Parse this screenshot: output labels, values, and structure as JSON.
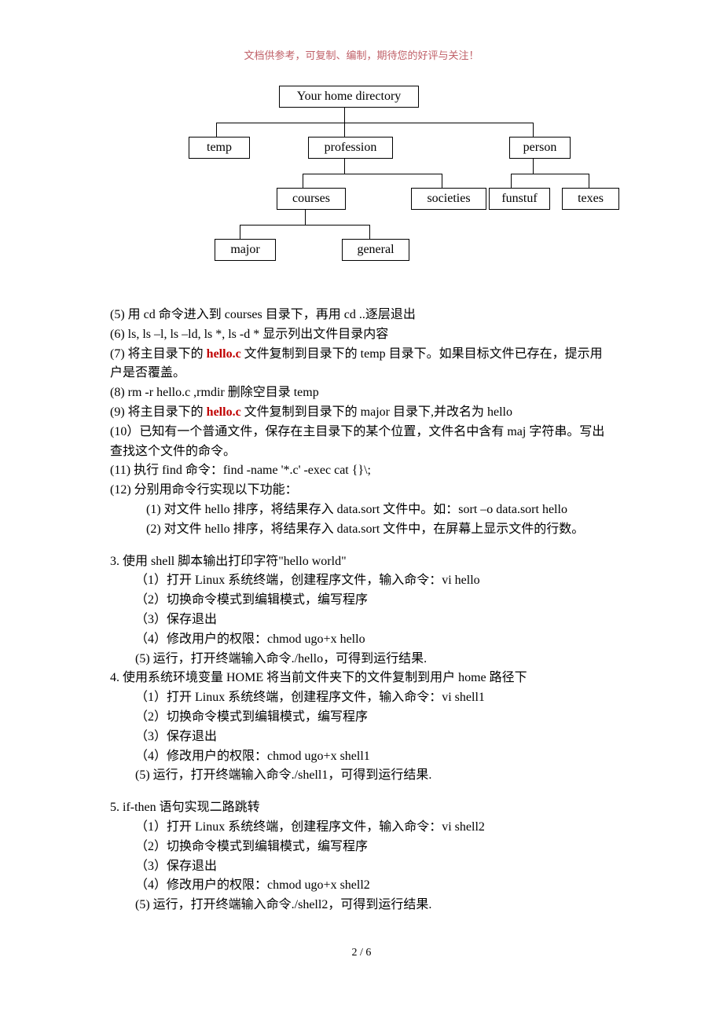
{
  "header_note": "文档供参考，可复制、编制，期待您的好评与关注！",
  "diagram": {
    "root": "Your home directory",
    "l1": {
      "a": "temp",
      "b": "profession",
      "c": "person"
    },
    "l2": {
      "a": "courses",
      "b": "societies",
      "c": "funstuf",
      "d": "texes"
    },
    "l3": {
      "a": "major",
      "b": "general"
    }
  },
  "body": {
    "p5": "(5) 用 cd 命令进入到 courses 目录下，再用 cd ..逐层退出",
    "p6": "(6) ls,  ls –l, ls –ld,    ls *, ls -d *  显示列出文件目录内容",
    "p7a": "(7) 将主目录下的 ",
    "p7file": "hello.c",
    "p7b": " 文件复制到目录下的 temp 目录下。如果目标文件已存在，提示用户是否覆盖。",
    "p8": "(8) rm -r hello.c ,rmdir  删除空目录 temp",
    "p9a": "(9) 将主目录下的 ",
    "p9file": "hello.c",
    "p9b": " 文件复制到目录下的 major 目录下,并改名为 hello",
    "p10": "(10）已知有一个普通文件，保存在主目录下的某个位置，文件名中含有 maj 字符串。写出查找这个文件的命令。",
    "p11": "(11)  执行 find 命令：find -name '*.c' -exec cat {}\\;",
    "p12": "(12) 分别用命令行实现以下功能：",
    "p12_1": "(1) 对文件 hello 排序，将结果存入 data.sort 文件中。如：sort –o data.sort hello",
    "p12_2": "(2) 对文件 hello 排序，将结果存入 data.sort 文件中，在屏幕上显示文件的行数。",
    "s3": "3.  使用 shell 脚本输出打印字符\"hello world\"",
    "s3_1": "（1）打开 Linux 系统终端，创建程序文件，输入命令：vi hello",
    "s3_2": "（2）切换命令模式到编辑模式，编写程序",
    "s3_3": "（3）保存退出",
    "s3_4": "（4）修改用户的权限：chmod ugo+x hello",
    "s3_5": "(5) 运行，打开终端输入命令./hello，可得到运行结果.",
    "s4": "4.  使用系统环境变量 HOME 将当前文件夹下的文件复制到用户 home 路径下",
    "s4_1": "（1）打开 Linux 系统终端，创建程序文件，输入命令：vi shell1",
    "s4_2": "（2）切换命令模式到编辑模式，编写程序",
    "s4_3": "（3）保存退出",
    "s4_4": "（4）修改用户的权限：chmod ugo+x shell1",
    "s4_5": "(5) 运行，打开终端输入命令./shell1，可得到运行结果.",
    "s5": "5. if-then 语句实现二路跳转",
    "s5_1": "（1）打开 Linux 系统终端，创建程序文件，输入命令：vi shell2",
    "s5_2": "（2）切换命令模式到编辑模式，编写程序",
    "s5_3": "（3）保存退出",
    "s5_4": "（4）修改用户的权限：chmod ugo+x shell2",
    "s5_5": "(5) 运行，打开终端输入命令./shell2，可得到运行结果."
  },
  "footer": "2  /  6"
}
